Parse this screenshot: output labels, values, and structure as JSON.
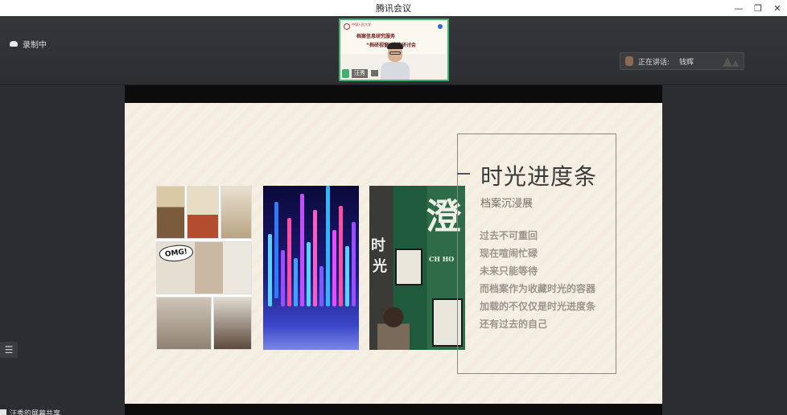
{
  "window": {
    "title": "腾讯会议",
    "controls": [
      "—",
      "❐",
      "✕"
    ]
  },
  "topbar": {
    "recording_label": "录制中",
    "speaker_tile": {
      "org_text": "中国人民大学",
      "banner_line1": "档案信息研究服务",
      "banner_line2": "“档研视窗”策略研讨会",
      "name": "汪秀"
    },
    "speaking_label": "正在讲话:",
    "speaking_name": "钱辉"
  },
  "slide": {
    "title": "时光进度条",
    "subtitle": "档案沉浸展",
    "bullets": [
      "过去不可重回",
      "现在喧闹忙碌",
      "未来只能等待",
      "而档案作为收藏时光的容器",
      "加载的不仅仅是时光进度条",
      "还有过去的自己"
    ],
    "photo1_bubble": "OMG!",
    "photo3_chars": [
      "时",
      "光",
      "澄",
      "CH HO"
    ]
  },
  "bottom": {
    "share_status": "汪秀的屏幕共享"
  },
  "colors": {
    "accent_green": "#3fb06d",
    "slide_bg": "#f6f0e4",
    "app_bg": "#2b2d30"
  }
}
